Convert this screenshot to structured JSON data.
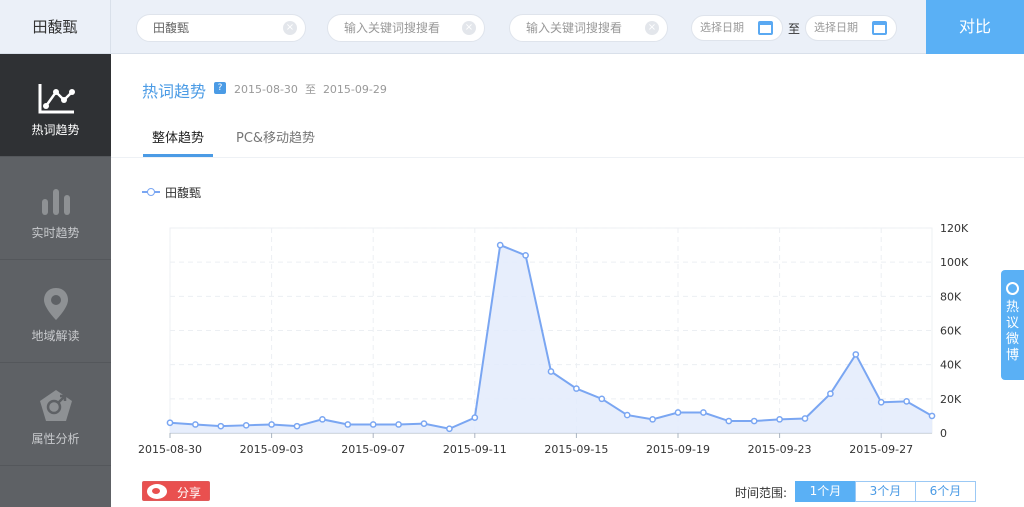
{
  "topbar": {
    "brand": "田馥甄",
    "keyword1": "田馥甄",
    "keyword2_placeholder": "输入关键词搜搜看",
    "keyword3_placeholder": "输入关键词搜搜看",
    "date_start_placeholder": "选择日期",
    "date_to": "至",
    "date_end_placeholder": "选择日期",
    "compare_label": "对比"
  },
  "sidebar": {
    "items": [
      {
        "label": "热词趋势",
        "icon": "line-chart-icon",
        "active": true
      },
      {
        "label": "实时趋势",
        "icon": "bar-chart-icon",
        "active": false
      },
      {
        "label": "地域解读",
        "icon": "location-pin-icon",
        "active": false
      },
      {
        "label": "属性分析",
        "icon": "gender-icon",
        "active": false
      }
    ]
  },
  "header": {
    "title": "热词趋势",
    "help": "?",
    "date_from": "2015-08-30",
    "date_sep": "至",
    "date_to": "2015-09-29"
  },
  "tabs": [
    {
      "label": "整体趋势",
      "active": true
    },
    {
      "label": "PC&移动趋势",
      "active": false
    }
  ],
  "legend": {
    "name": "田馥甄"
  },
  "float_tab": {
    "label": "热议微博"
  },
  "footer": {
    "share_label": "分享",
    "time_range_label": "时间范围:",
    "ranges": [
      {
        "label": "1个月",
        "active": true
      },
      {
        "label": "3个月",
        "active": false
      },
      {
        "label": "6个月",
        "active": false
      }
    ]
  },
  "colors": {
    "accent": "#5ab0f5",
    "line": "#7aa6f2",
    "area": "#e3ebfb"
  },
  "chart_data": {
    "type": "area",
    "x": [
      "2015-08-30",
      "2015-08-31",
      "2015-09-01",
      "2015-09-02",
      "2015-09-03",
      "2015-09-04",
      "2015-09-05",
      "2015-09-06",
      "2015-09-07",
      "2015-09-08",
      "2015-09-09",
      "2015-09-10",
      "2015-09-11",
      "2015-09-12",
      "2015-09-13",
      "2015-09-14",
      "2015-09-15",
      "2015-09-16",
      "2015-09-17",
      "2015-09-18",
      "2015-09-19",
      "2015-09-20",
      "2015-09-21",
      "2015-09-22",
      "2015-09-23",
      "2015-09-24",
      "2015-09-25",
      "2015-09-26",
      "2015-09-27",
      "2015-09-28",
      "2015-09-29"
    ],
    "x_tick_labels": [
      "2015-08-30",
      "2015-09-03",
      "2015-09-07",
      "2015-09-11",
      "2015-09-15",
      "2015-09-19",
      "2015-09-23",
      "2015-09-27"
    ],
    "series": [
      {
        "name": "田馥甄",
        "values": [
          6000,
          5000,
          4000,
          4500,
          5000,
          4000,
          8000,
          5000,
          5000,
          5000,
          5500,
          2500,
          9000,
          110000,
          104000,
          36000,
          26000,
          20000,
          10500,
          8000,
          12000,
          12000,
          7000,
          7000,
          8000,
          8500,
          23000,
          46000,
          18000,
          18500,
          10000
        ]
      }
    ],
    "ylim": [
      0,
      120000
    ],
    "y_tick_labels": [
      "0",
      "20K",
      "40K",
      "60K",
      "80K",
      "100K",
      "120K"
    ],
    "y_axis_position": "right",
    "grid": true
  }
}
